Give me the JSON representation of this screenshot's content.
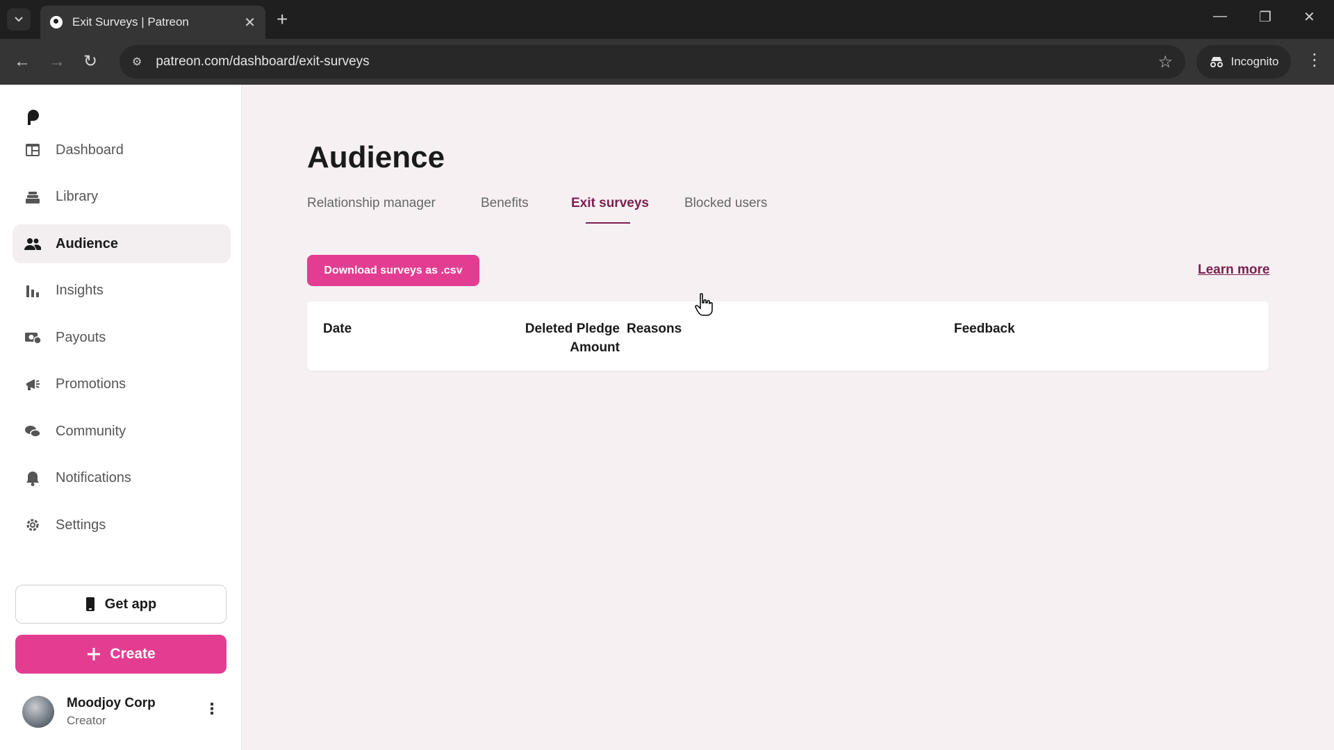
{
  "browser": {
    "tab_title": "Exit Surveys | Patreon",
    "url": "patreon.com/dashboard/exit-surveys",
    "incognito_label": "Incognito"
  },
  "sidebar": {
    "items": [
      {
        "label": "Dashboard",
        "icon": "dashboard-icon"
      },
      {
        "label": "Library",
        "icon": "library-icon"
      },
      {
        "label": "Audience",
        "icon": "audience-icon",
        "active": true
      },
      {
        "label": "Insights",
        "icon": "insights-icon"
      },
      {
        "label": "Payouts",
        "icon": "payouts-icon"
      },
      {
        "label": "Promotions",
        "icon": "megaphone-icon"
      },
      {
        "label": "Community",
        "icon": "chat-bubbles-icon"
      },
      {
        "label": "Notifications",
        "icon": "bell-icon"
      },
      {
        "label": "Settings",
        "icon": "gear-icon"
      }
    ],
    "get_app_label": "Get app",
    "create_label": "Create",
    "user": {
      "name": "Moodjoy Corp",
      "role": "Creator"
    }
  },
  "main": {
    "title": "Audience",
    "tabs": [
      {
        "label": "Relationship manager"
      },
      {
        "label": "Benefits"
      },
      {
        "label": "Exit surveys",
        "active": true
      },
      {
        "label": "Blocked users"
      }
    ],
    "download_label": "Download surveys as .csv",
    "learn_more_label": "Learn more",
    "table": {
      "columns": [
        "Date",
        "Deleted Pledge",
        "Amount",
        "Reasons",
        "Feedback"
      ]
    }
  },
  "colors": {
    "accent": "#e33d92",
    "active_tab": "#7b1f4f",
    "page_bg": "#f6f0f2"
  }
}
